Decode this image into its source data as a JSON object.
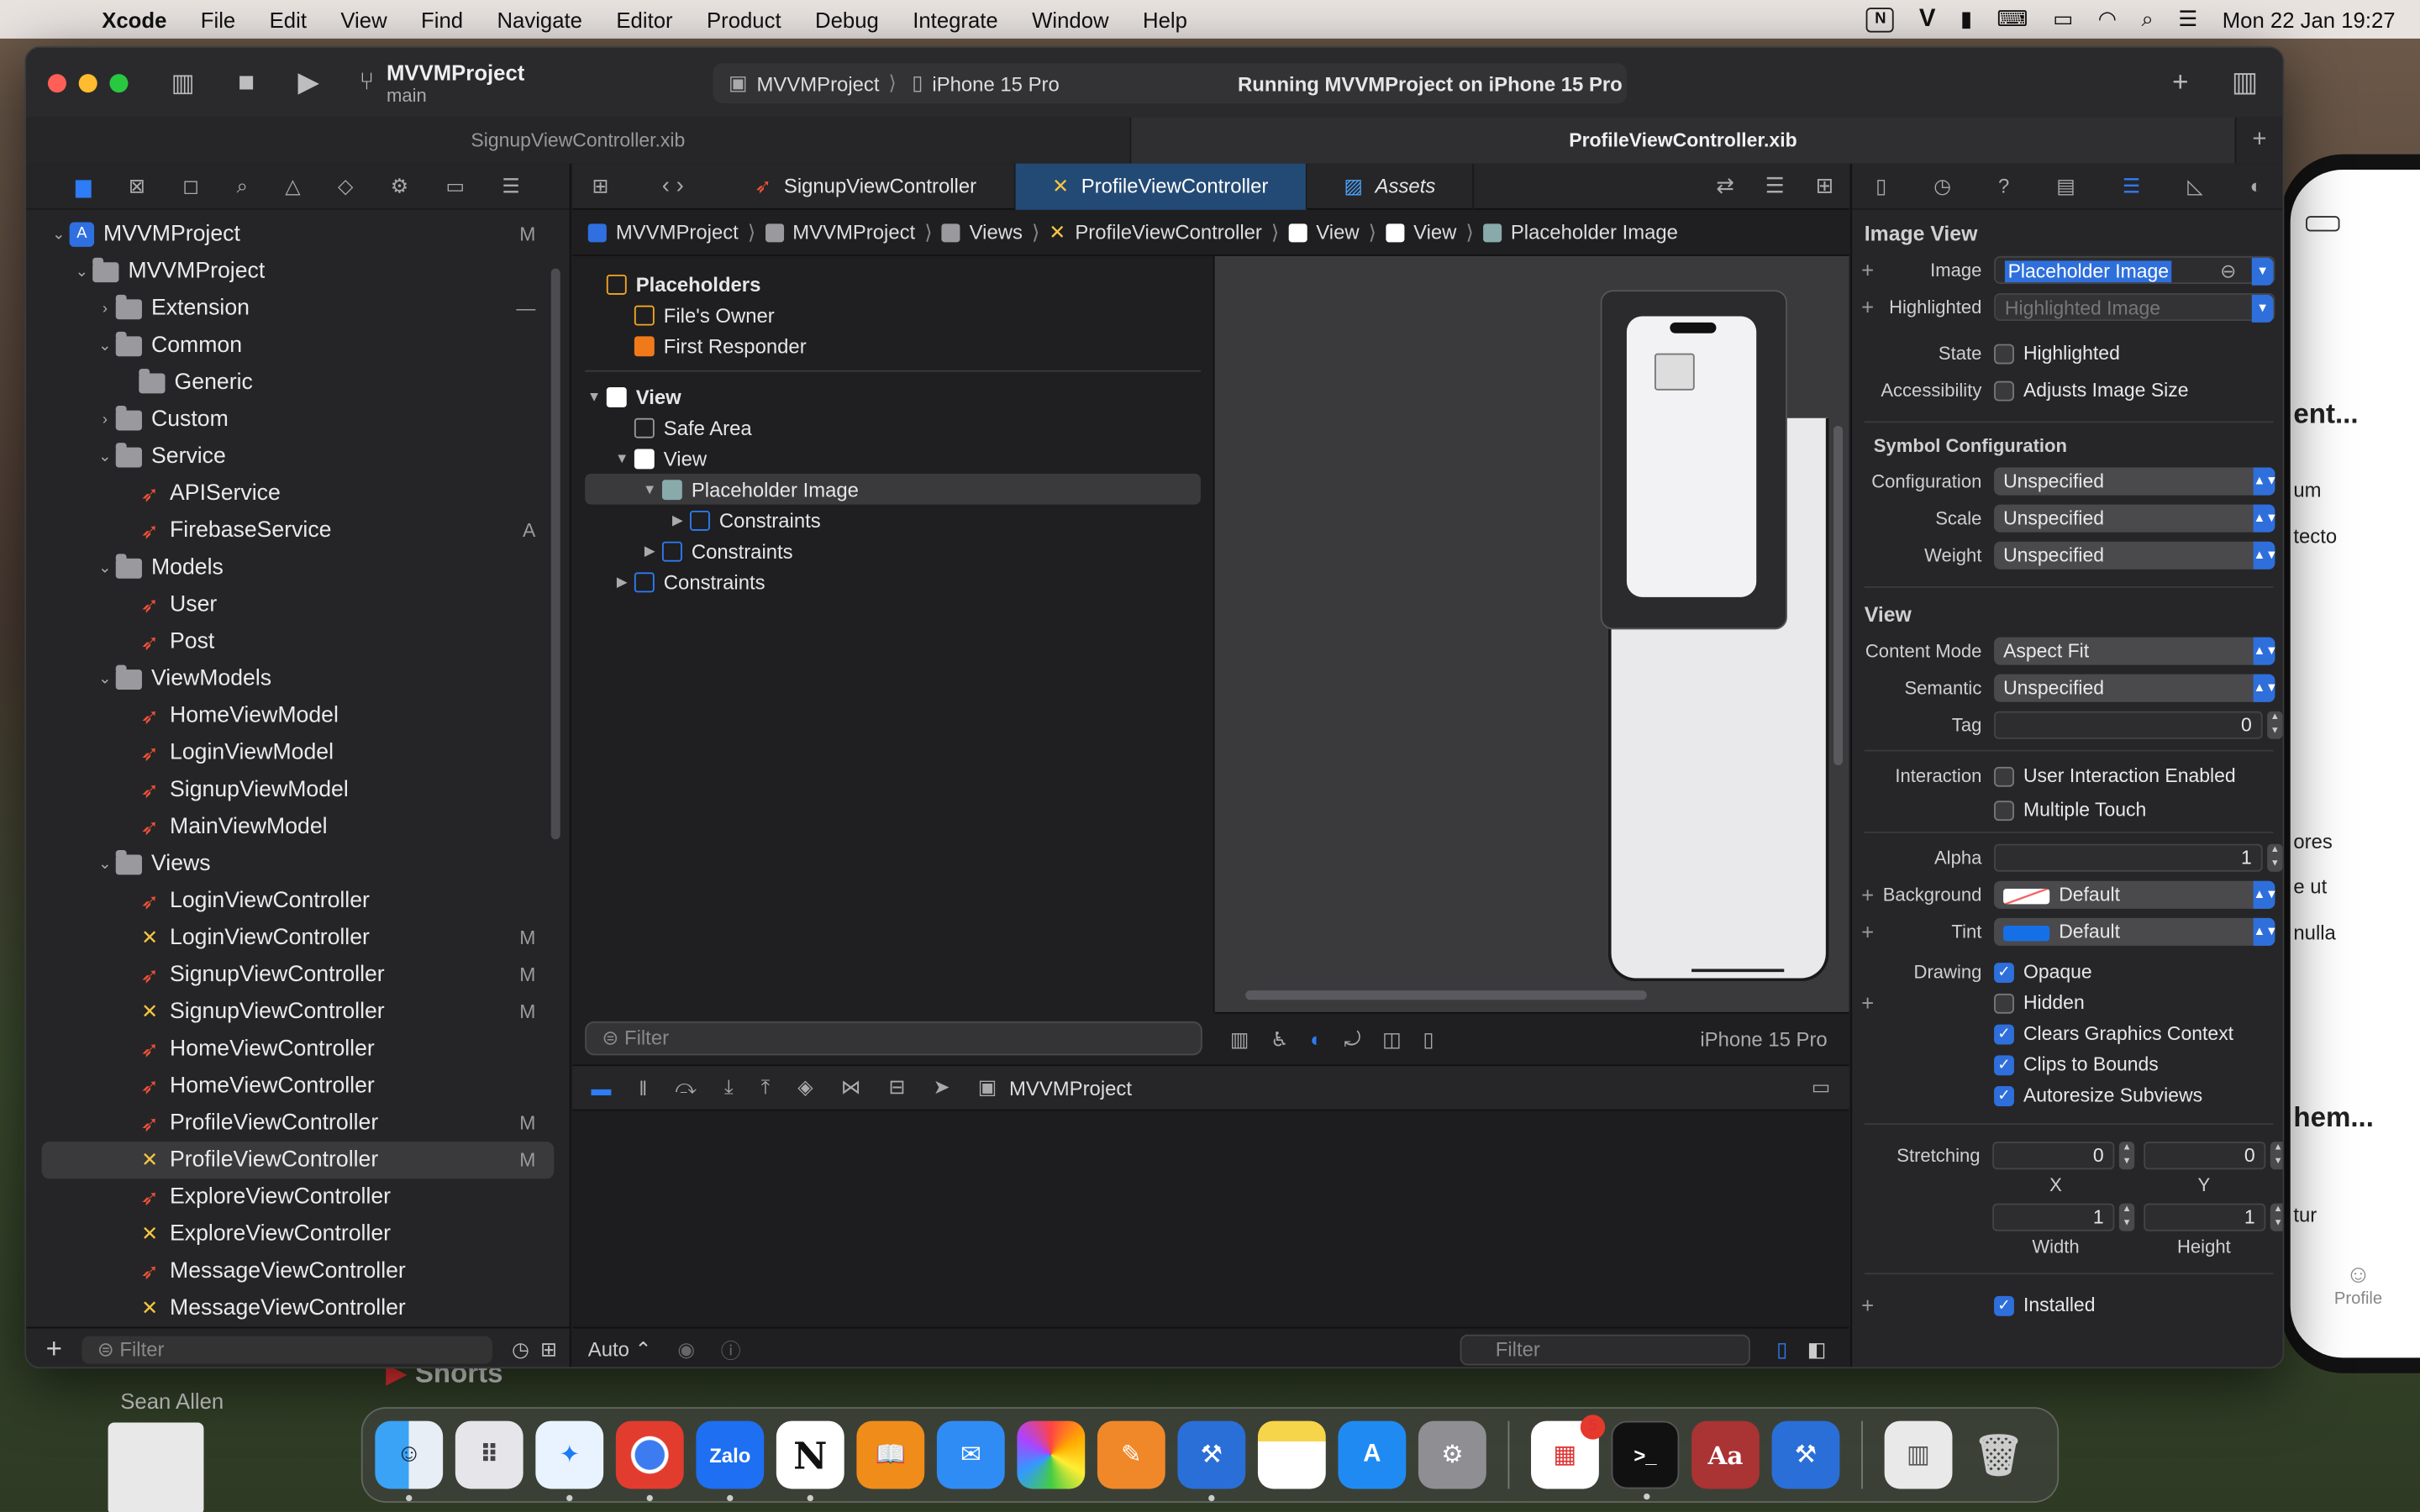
{
  "menubar": {
    "app": "Xcode",
    "items": [
      "File",
      "Edit",
      "View",
      "Find",
      "Navigate",
      "Editor",
      "Product",
      "Debug",
      "Integrate",
      "Window",
      "Help"
    ],
    "clock": "Mon 22 Jan  19:27"
  },
  "toolbar": {
    "scheme_name": "MVVMProject",
    "branch": "main",
    "dest_project": "MVVMProject",
    "dest_device": "iPhone 15 Pro",
    "status": "Running MVVMProject on iPhone 15 Pro"
  },
  "file_tabs": [
    "SignupViewController.xib",
    "ProfileViewController.xib"
  ],
  "navigator": {
    "tree": [
      {
        "label": "MVVMProject",
        "kind": "project",
        "depth": 0,
        "open": true,
        "badge": "M"
      },
      {
        "label": "MVVMProject",
        "kind": "folder",
        "depth": 1,
        "open": true,
        "badge": ""
      },
      {
        "label": "Extension",
        "kind": "folder",
        "depth": 2,
        "open": false,
        "badge": "—"
      },
      {
        "label": "Common",
        "kind": "folder",
        "depth": 2,
        "open": true,
        "badge": ""
      },
      {
        "label": "Generic",
        "kind": "folder",
        "depth": 3,
        "open": null,
        "badge": ""
      },
      {
        "label": "Custom",
        "kind": "folder",
        "depth": 2,
        "open": false,
        "badge": ""
      },
      {
        "label": "Service",
        "kind": "folder",
        "depth": 2,
        "open": true,
        "badge": ""
      },
      {
        "label": "APIService",
        "kind": "swift",
        "depth": 3,
        "open": null,
        "badge": ""
      },
      {
        "label": "FirebaseService",
        "kind": "swift",
        "depth": 3,
        "open": null,
        "badge": "A"
      },
      {
        "label": "Models",
        "kind": "folder",
        "depth": 2,
        "open": true,
        "badge": ""
      },
      {
        "label": "User",
        "kind": "swift",
        "depth": 3,
        "open": null,
        "badge": ""
      },
      {
        "label": "Post",
        "kind": "swift",
        "depth": 3,
        "open": null,
        "badge": ""
      },
      {
        "label": "ViewModels",
        "kind": "folder",
        "depth": 2,
        "open": true,
        "badge": ""
      },
      {
        "label": "HomeViewModel",
        "kind": "swift",
        "depth": 3,
        "open": null,
        "badge": ""
      },
      {
        "label": "LoginViewModel",
        "kind": "swift",
        "depth": 3,
        "open": null,
        "badge": ""
      },
      {
        "label": "SignupViewModel",
        "kind": "swift",
        "depth": 3,
        "open": null,
        "badge": ""
      },
      {
        "label": "MainViewModel",
        "kind": "swift",
        "depth": 3,
        "open": null,
        "badge": ""
      },
      {
        "label": "Views",
        "kind": "folder",
        "depth": 2,
        "open": true,
        "badge": ""
      },
      {
        "label": "LoginViewController",
        "kind": "swift",
        "depth": 3,
        "open": null,
        "badge": ""
      },
      {
        "label": "LoginViewController",
        "kind": "xib",
        "depth": 3,
        "open": null,
        "badge": "M"
      },
      {
        "label": "SignupViewController",
        "kind": "swift",
        "depth": 3,
        "open": null,
        "badge": "M"
      },
      {
        "label": "SignupViewController",
        "kind": "xib",
        "depth": 3,
        "open": null,
        "badge": "M"
      },
      {
        "label": "HomeViewController",
        "kind": "swift",
        "depth": 3,
        "open": null,
        "badge": ""
      },
      {
        "label": "HomeViewController",
        "kind": "swift",
        "depth": 3,
        "open": null,
        "badge": ""
      },
      {
        "label": "ProfileViewController",
        "kind": "swift",
        "depth": 3,
        "open": null,
        "badge": "M"
      },
      {
        "label": "ProfileViewController",
        "kind": "xib",
        "depth": 3,
        "open": null,
        "badge": "M",
        "selected": true
      },
      {
        "label": "ExploreViewController",
        "kind": "swift",
        "depth": 3,
        "open": null,
        "badge": ""
      },
      {
        "label": "ExploreViewController",
        "kind": "xib",
        "depth": 3,
        "open": null,
        "badge": ""
      },
      {
        "label": "MessageViewController",
        "kind": "swift",
        "depth": 3,
        "open": null,
        "badge": ""
      },
      {
        "label": "MessageViewController",
        "kind": "xib",
        "depth": 3,
        "open": null,
        "badge": ""
      }
    ],
    "filter_placeholder": "Filter"
  },
  "editor": {
    "tabs": [
      "SignupViewController",
      "ProfileViewController",
      "Assets"
    ],
    "breadcrumb": [
      "MVVMProject",
      "MVVMProject",
      "Views",
      "ProfileViewController",
      "View",
      "View",
      "Placeholder Image"
    ],
    "outline": {
      "placeholders": "Placeholders",
      "files_owner": "File's Owner",
      "first_responder": "First Responder",
      "view": "View",
      "safe_area": "Safe Area",
      "inner_view": "View",
      "placeholder_image": "Placeholder Image",
      "constraints_1": "Constraints",
      "constraints_2": "Constraints",
      "constraints_3": "Constraints"
    },
    "filter_placeholder": "Filter",
    "device_label": "iPhone 15 Pro",
    "debug_project": "MVVMProject",
    "auto_label": "Auto ⌃",
    "debug_filter": "Filter"
  },
  "inspector": {
    "image_view_title": "Image View",
    "image_label": "Image",
    "image_value": "Placeholder Image",
    "highlighted_label": "Highlighted",
    "highlighted_placeholder": "Highlighted Image",
    "state_label": "State",
    "state_check": "Highlighted",
    "accessibility_label": "Accessibility",
    "accessibility_check": "Adjusts Image Size",
    "symbol_config_title": "Symbol Configuration",
    "configuration_label": "Configuration",
    "configuration_value": "Unspecified",
    "scale_label": "Scale",
    "scale_value": "Unspecified",
    "weight_label": "Weight",
    "weight_value": "Unspecified",
    "view_title": "View",
    "content_mode_label": "Content Mode",
    "content_mode_value": "Aspect Fit",
    "semantic_label": "Semantic",
    "semantic_value": "Unspecified",
    "tag_label": "Tag",
    "tag_value": "0",
    "interaction_label": "Interaction",
    "interaction_1": "User Interaction Enabled",
    "interaction_2": "Multiple Touch",
    "alpha_label": "Alpha",
    "alpha_value": "1",
    "background_label": "Background",
    "background_value": "Default",
    "tint_label": "Tint",
    "tint_value": "Default",
    "drawing_label": "Drawing",
    "drawing_opaque": "Opaque",
    "drawing_hidden": "Hidden",
    "drawing_clears": "Clears Graphics Context",
    "drawing_clips": "Clips to Bounds",
    "drawing_autoresize": "Autoresize Subviews",
    "stretching_label": "Stretching",
    "stretch_x": "0",
    "stretch_y": "0",
    "stretch_w": "1",
    "stretch_h": "1",
    "cap_x": "X",
    "cap_y": "Y",
    "cap_w": "Width",
    "cap_h": "Height",
    "installed": "Installed"
  },
  "simulator_snippets": [
    "ent...",
    "um",
    "tecto",
    "ores",
    "e ut",
    "nulla",
    "hem...",
    "tur",
    "Profile"
  ],
  "behind_window": {
    "shorts": "Shorts",
    "name": "Sean Allen"
  },
  "dock": {
    "apps": [
      "Finder",
      "Launchpad",
      "Safari",
      "Chrome",
      "Zalo",
      "Notion",
      "Books",
      "Mail",
      "Photos",
      "Pages",
      "Xcode",
      "Notes",
      "App Store",
      "System Settings",
      "Office",
      "Terminal",
      "Dictionary",
      "Instruments"
    ],
    "office_badge": "5",
    "zalo_text": "Zalo",
    "notion_text": "N",
    "dict_text": "Aa"
  }
}
